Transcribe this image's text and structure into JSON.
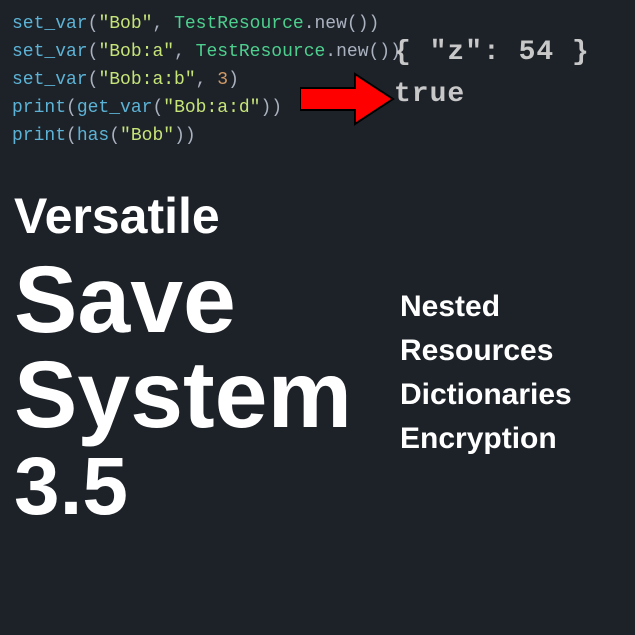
{
  "code": {
    "l1": {
      "fn": "set_var",
      "str": "\"Bob\"",
      "cls": "TestResource",
      "suffix": ".new())"
    },
    "l2": {
      "fn": "set_var",
      "str": "\"Bob:a\"",
      "cls": "TestResource",
      "suffix": ".new())"
    },
    "l3": {
      "fn": "set_var",
      "str": "\"Bob:a:b\"",
      "num": "3"
    },
    "l4": {
      "fn1": "print",
      "fn2": "get_var",
      "str": "\"Bob:a:d\""
    },
    "l5": {
      "fn1": "print",
      "fn2": "has",
      "str": "\"Bob\""
    }
  },
  "output": {
    "line1": "{ \"z\": 54 }",
    "line2": "true"
  },
  "title": {
    "line1": "Versatile",
    "line2": "Save",
    "line3": "System",
    "line4": "3.5"
  },
  "features": {
    "f1": "Nested",
    "f2": "Resources",
    "f3": "Dictionaries",
    "f4": "Encryption"
  }
}
